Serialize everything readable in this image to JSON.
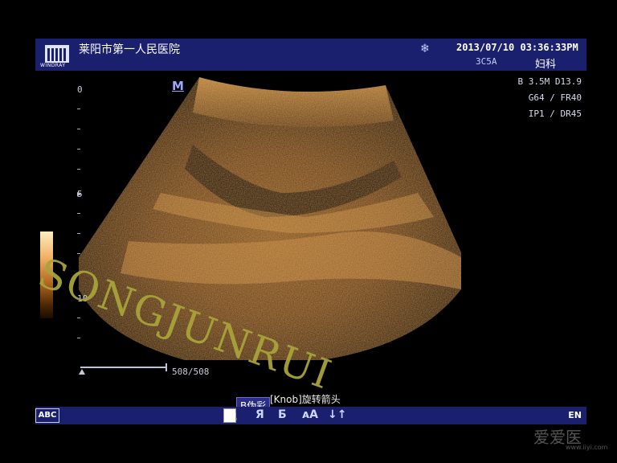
{
  "header": {
    "logo_text": "WINDRAY",
    "hospital": "莱阳市第一人民医院",
    "freeze_icon": "snowflake-icon",
    "datetime": "2013/07/10  03:36:33PM",
    "probe": "3C5A",
    "department": "妇科"
  },
  "params": {
    "line1": "B 3.5M D13.9",
    "line2": "G64 / FR40",
    "line3": "IP1 / DR45"
  },
  "image": {
    "mark": "M",
    "depth_labels": [
      "0",
      "5",
      "10"
    ],
    "scale_text": "508/508"
  },
  "status": {
    "hint": "[Knob]旋转箭头",
    "tooltip": "B伪彩"
  },
  "toolbar": {
    "abc": "ABC",
    "btn_r": "Я",
    "btn_b": "Ƃ",
    "btn_aa": "ᴀA",
    "btn_arrows": "↓↑",
    "lang": "EN"
  },
  "watermark": {
    "text": "SONGJUNRUI",
    "site_logo": "爱爱医",
    "site_url": "www.iiyi.com"
  }
}
